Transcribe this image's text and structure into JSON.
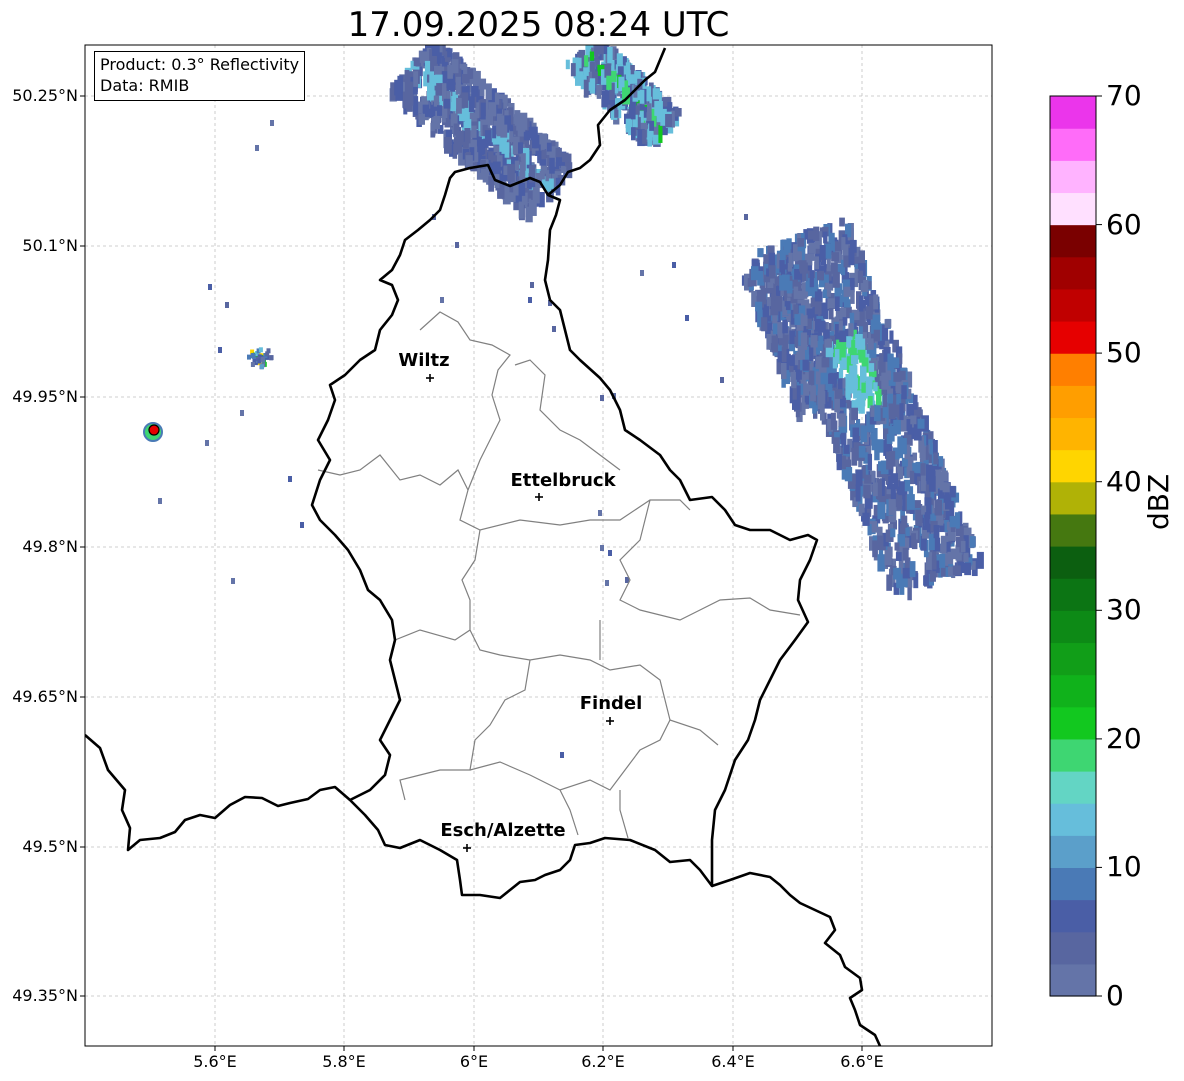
{
  "title": "17.09.2025 08:24 UTC",
  "info": {
    "product": "Product: 0.3° Reflectivity",
    "data": "Data: RMIB"
  },
  "lat_labels": [
    "50.25°N",
    "50.1°N",
    "49.95°N",
    "49.8°N",
    "49.65°N",
    "49.5°N",
    "49.35°N"
  ],
  "lon_labels": [
    "5.6°E",
    "5.8°E",
    "6°E",
    "6.2°E",
    "6.4°E",
    "6.6°E"
  ],
  "cities": [
    {
      "name": "Wiltz"
    },
    {
      "name": "Ettelbruck"
    },
    {
      "name": "Findel"
    },
    {
      "name": "Esch/Alzette"
    }
  ],
  "colorbar": {
    "label": "dBZ",
    "ticks": [
      "0",
      "10",
      "20",
      "30",
      "40",
      "50",
      "60",
      "70"
    ],
    "vmin": 0,
    "vmax": 70,
    "step": 2.5,
    "colors": [
      "#6474a8",
      "#5866a0",
      "#4a5ea6",
      "#4a7ab6",
      "#5b9fca",
      "#66bedb",
      "#63d5c4",
      "#3ed672",
      "#12c81f",
      "#10b21b",
      "#119e18",
      "#0d8a16",
      "#0c7514",
      "#0c5f10",
      "#457810",
      "#b0b206",
      "#ffd500",
      "#ffb400",
      "#ff9e00",
      "#ff7f00",
      "#e60000",
      "#c00000",
      "#a00000",
      "#7a0000",
      "#ffe0ff",
      "#ffb3ff",
      "#ff6cf9",
      "#eb35eb"
    ]
  }
}
